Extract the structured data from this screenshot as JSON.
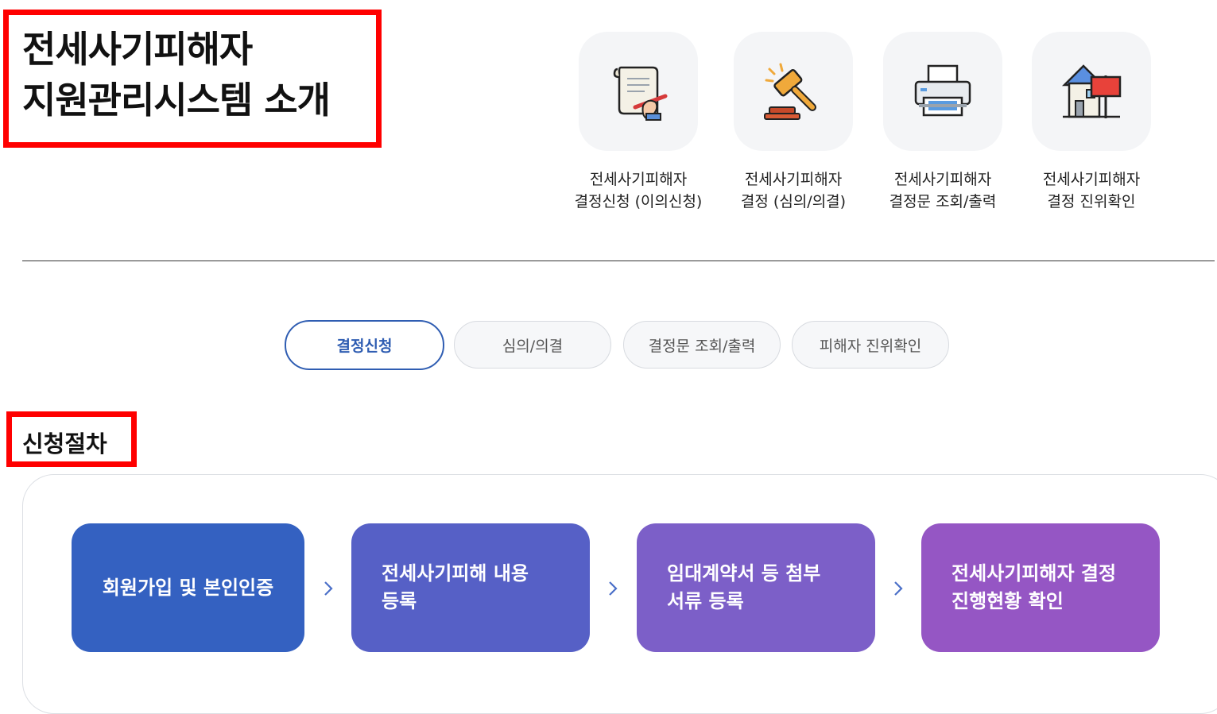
{
  "header": {
    "title_line1": "전세사기피해자",
    "title_line2": "지원관리시스템 소개"
  },
  "menu": [
    {
      "icon": "document-sign-icon",
      "line1": "전세사기피해자",
      "line2": "결정신청 (이의신청)"
    },
    {
      "icon": "gavel-icon",
      "line1": "전세사기피해자",
      "line2": "결정 (심의/의결)"
    },
    {
      "icon": "printer-icon",
      "line1": "전세사기피해자",
      "line2": "결정문 조회/출력"
    },
    {
      "icon": "house-sign-icon",
      "line1": "전세사기피해자",
      "line2": "결정 진위확인"
    }
  ],
  "tabs": [
    {
      "label": "결정신청",
      "active": true
    },
    {
      "label": "심의/의결",
      "active": false
    },
    {
      "label": "결정문 조회/출력",
      "active": false
    },
    {
      "label": "피해자 진위확인",
      "active": false
    }
  ],
  "section": {
    "title": "신청절차"
  },
  "steps": [
    {
      "line1": "회원가입 및 본인인증",
      "line2": "",
      "color": "#3461c1"
    },
    {
      "line1": "전세사기피해 내용",
      "line2": "등록",
      "color": "#5660c6"
    },
    {
      "line1": "임대계약서 등 첨부",
      "line2": "서류 등록",
      "color": "#7c5fc8"
    },
    {
      "line1": "전세사기피해자 결정",
      "line2": "진행현황 확인",
      "color": "#9556c4"
    }
  ],
  "colors": {
    "highlight_border": "#ff0000",
    "active_tab": "#2f5db2",
    "arrow": "#4a6fc8"
  }
}
